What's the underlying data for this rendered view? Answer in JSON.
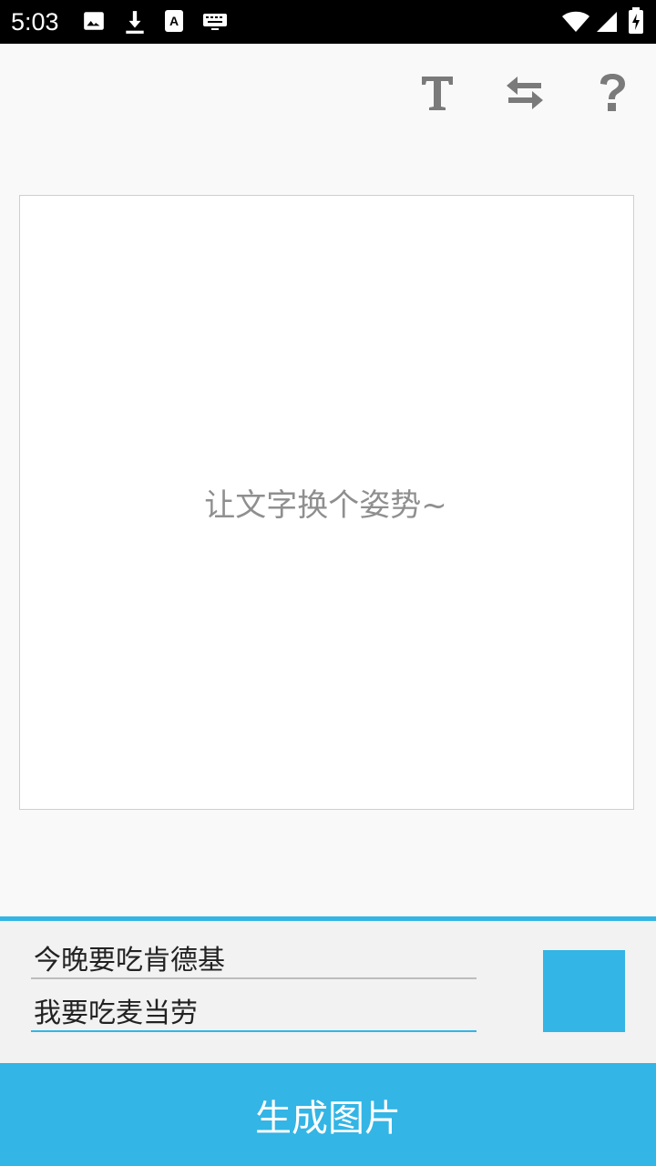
{
  "status_bar": {
    "time": "5:03",
    "icons": [
      "image-icon",
      "download-icon",
      "keyboard-a-icon",
      "keyboard-icon",
      "wifi-icon",
      "signal-icon",
      "battery-charging-icon"
    ]
  },
  "toolbar": {
    "icons": [
      "text-font-icon",
      "swap-arrows-icon",
      "help-question-icon"
    ],
    "icon_color": "#7a7a7a"
  },
  "canvas": {
    "placeholder": "让文字换个姿势~"
  },
  "inputs": {
    "line1_value": "今晚要吃肯德基",
    "line2_value": "我要吃麦当劳"
  },
  "color_picker": {
    "selected_color": "#33b5e5"
  },
  "generate_button": {
    "label": "生成图片",
    "color": "#33b5e5"
  }
}
